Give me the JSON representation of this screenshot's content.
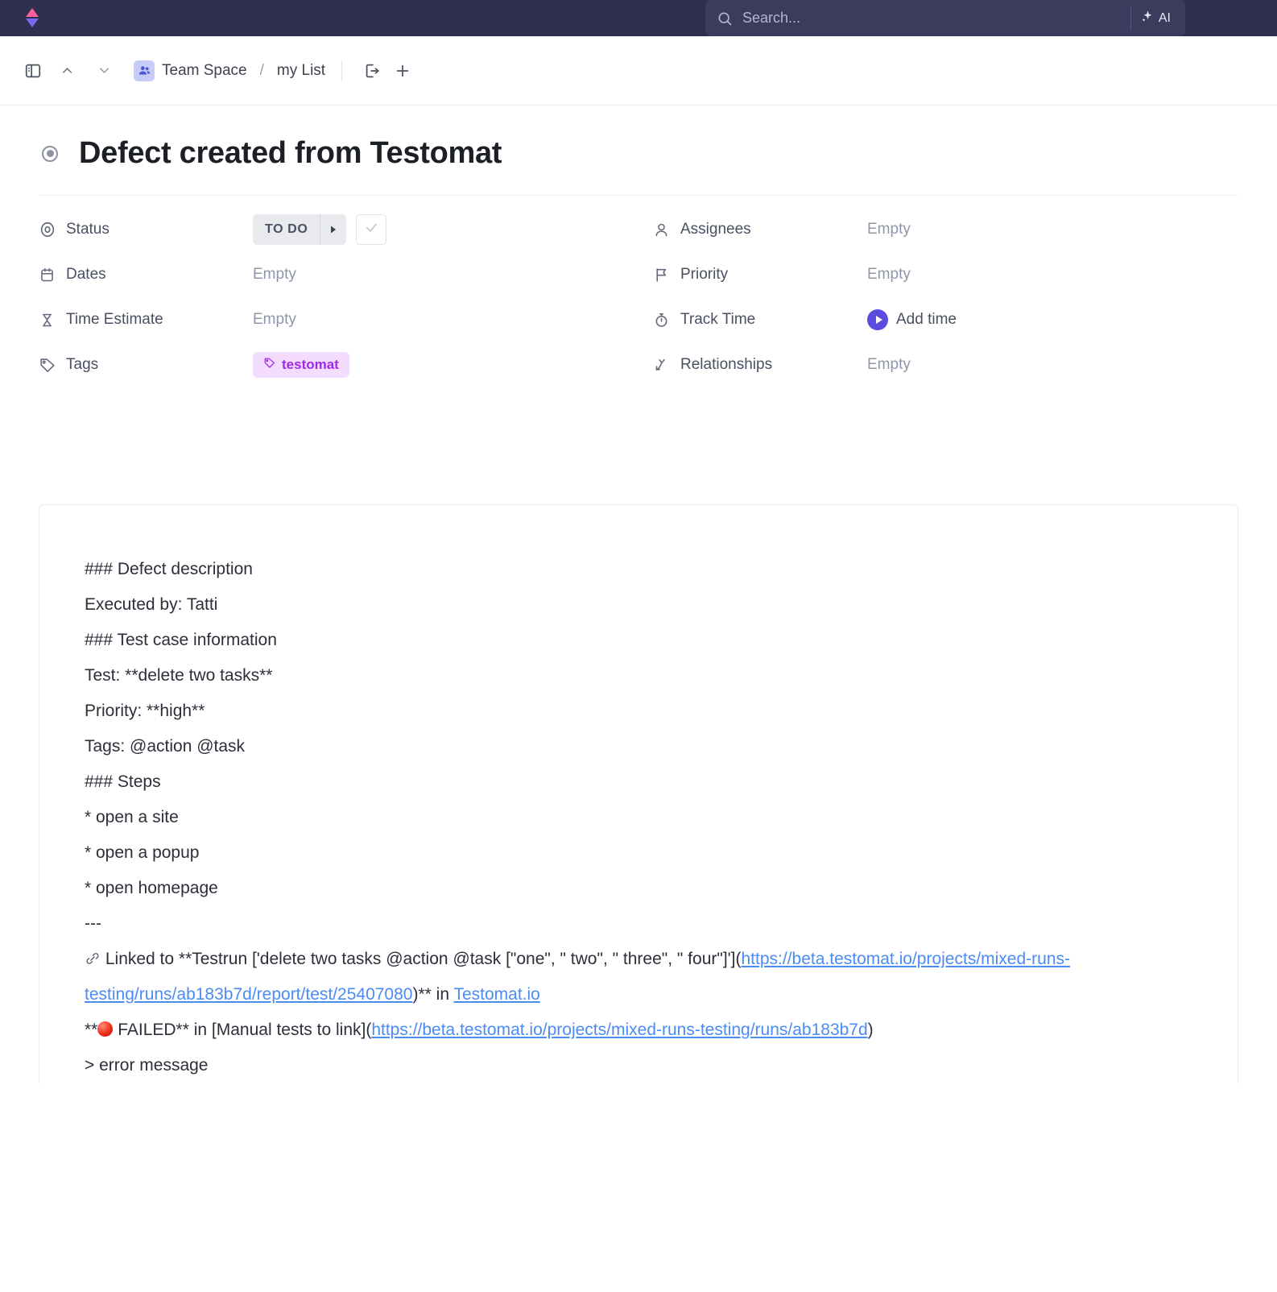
{
  "topbar": {
    "brand_icon": "clickup-logo",
    "search": {
      "placeholder": "Search...",
      "value": "",
      "icon": "search-icon"
    },
    "ai_label": "AI",
    "ai_icon": "sparkle-icon",
    "bg_color": "#2e2e4f"
  },
  "toolbar": {
    "sidebar_toggle_icon": "panel-toggle-icon",
    "prev_icon": "chevron-up-icon",
    "next_icon": "chevron-down-icon",
    "breadcrumb": {
      "space_icon": "people-icon",
      "space": "Team Space",
      "separator": "/",
      "list": "my List"
    },
    "open_icon": "open-in-new-icon",
    "add_icon": "plus-icon"
  },
  "task": {
    "status_bullet_icon": "status-circle-icon",
    "title": "Defect created from Testomat",
    "properties_left": [
      {
        "icon": "target-icon",
        "label": "Status",
        "value_type": "status"
      },
      {
        "icon": "calendar-icon",
        "label": "Dates",
        "value": "Empty",
        "value_type": "empty"
      },
      {
        "icon": "hourglass-icon",
        "label": "Time Estimate",
        "value": "Empty",
        "value_type": "empty"
      },
      {
        "icon": "tag-icon",
        "label": "Tags",
        "value_type": "tags"
      }
    ],
    "properties_right": [
      {
        "icon": "person-icon",
        "label": "Assignees",
        "value": "Empty",
        "value_type": "empty"
      },
      {
        "icon": "flag-icon",
        "label": "Priority",
        "value": "Empty",
        "value_type": "empty"
      },
      {
        "icon": "stopwatch-icon",
        "label": "Track Time",
        "value_type": "track"
      },
      {
        "icon": "relationship-icon",
        "label": "Relationships",
        "value": "Empty",
        "value_type": "empty"
      }
    ],
    "status": {
      "label": "TO DO",
      "dropdown_icon": "caret-right-icon",
      "complete_icon": "check-icon"
    },
    "tags": [
      {
        "label": "testomat",
        "icon": "tag-icon",
        "color": "#a128e8",
        "bg": "#f4dcfd"
      }
    ],
    "track_time": {
      "label": "Add time",
      "icon": "play-icon"
    }
  },
  "description": {
    "line_defect_heading": "### Defect description",
    "line_executed_by": "Executed by: Tatti",
    "line_testcase_heading": "### Test case information",
    "line_test": "Test: **delete two tasks**",
    "line_priority": "Priority: **high**",
    "line_tags": "Tags: @action @task",
    "line_steps_heading": "### Steps",
    "step_1": "* open a site",
    "step_2": "* open a popup",
    "step_3": "* open homepage",
    "line_divider": "---",
    "linked_icon": "link-icon",
    "linked_prefix": "Linked to **Testrun ['delete two tasks @action @task [\"one\", \" two\", \" three\", \" four\"]'](",
    "linked_url": "https://beta.testomat.io/projects/mixed-runs-testing/runs/ab183b7d/report/test/25407080",
    "linked_suffix": ")** in ",
    "linked_site": "Testomat.io",
    "failed_prefix": "**",
    "failed_label": " FAILED** in [Manual tests to link](",
    "failed_url": "https://beta.testomat.io/projects/mixed-runs-testing/runs/ab183b7d",
    "failed_suffix": ")",
    "error_quote": "> error message"
  }
}
